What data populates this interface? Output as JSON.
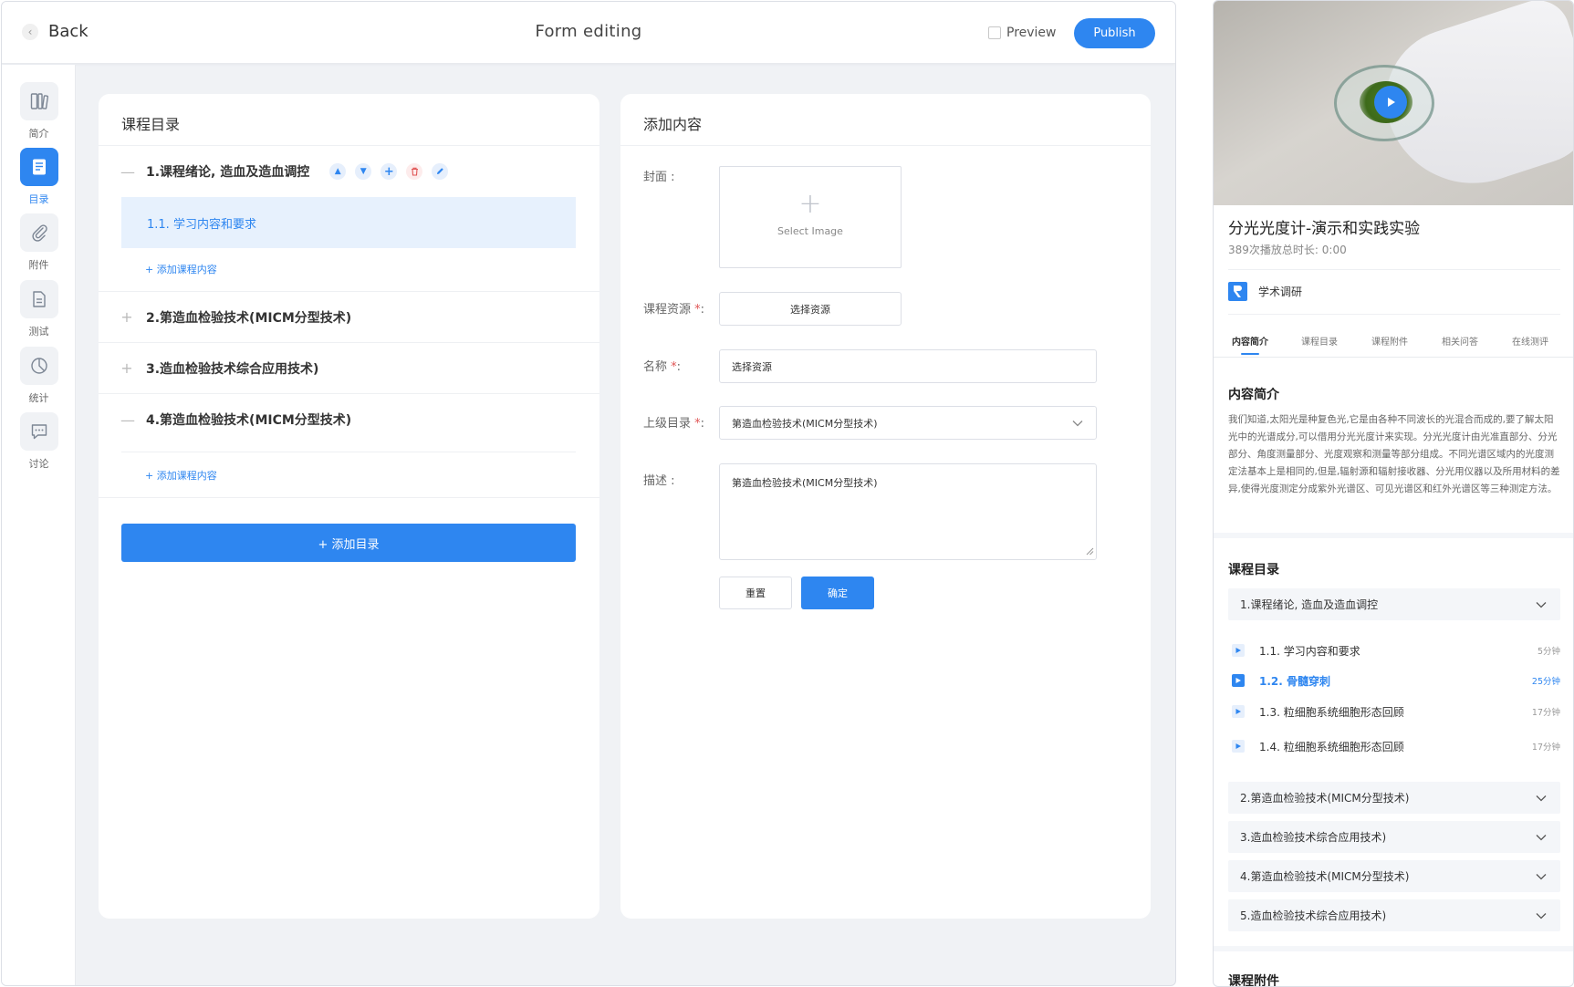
{
  "editor": {
    "topbar": {
      "back_label": "Back",
      "title": "Form editing",
      "preview_label": "Preview",
      "publish_label": "Publish"
    },
    "nav": [
      {
        "label": "简介",
        "icon": "book-icon",
        "active": false
      },
      {
        "label": "目录",
        "icon": "document-icon",
        "active": true
      },
      {
        "label": "附件",
        "icon": "paperclip-icon",
        "active": false
      },
      {
        "label": "测试",
        "icon": "test-sheet-icon",
        "active": false
      },
      {
        "label": "统计",
        "icon": "clock-chart-icon",
        "active": false
      },
      {
        "label": "讨论",
        "icon": "chat-icon",
        "active": false
      }
    ],
    "catalog": {
      "title": "课程目录",
      "chapters": [
        {
          "name": "1.课程绪论, 造血及造血调控",
          "expanded": true
        },
        {
          "name": "2.第造血检验技术(MICM分型技术)",
          "expanded": false
        },
        {
          "name": "3.造血检验技术综合应用技术)",
          "expanded": false
        },
        {
          "name": "4.第造血检验技术(MICM分型技术)",
          "expanded": true
        }
      ],
      "sub_item": "1.1. 学习内容和要求",
      "add_content": "+ 添加课程内容",
      "add_dir": "+ 添加目录"
    },
    "form": {
      "title": "添加内容",
      "cover_label": "封面 :",
      "select_image": "Select Image",
      "resource_label": "课程资源",
      "resource_button": "选择资源",
      "name_label": "名称",
      "name_value": "选择资源",
      "parent_label": "上级目录",
      "parent_value": "第造血检验技术(MICM分型技术)",
      "desc_label": "描述 :",
      "desc_value": "第造血检验技术(MICM分型技术)",
      "reset": "重置",
      "confirm": "确定",
      "required_mark": "*",
      "colon": ":"
    }
  },
  "preview": {
    "title": "分光光度计-演示和实践实验",
    "meta": "389次播放总时长: 0:00",
    "author": "学术调研",
    "tabs": [
      "内容简介",
      "课程目录",
      "课程附件",
      "相关问答",
      "在线测评"
    ],
    "active_tab": "内容简介",
    "intro_heading": "内容简介",
    "intro_text": "我们知道,太阳光是种复色光,它是由各种不同波长的光混合而成的,要了解太阳光中的光谱成分,可以借用分光光度计来实现。分光光度计由光准直部分、分光部分、角度测量部分、光度观察和测量等部分组成。不同光谱区域内的光度测定法基本上是相同的,但是,辐射源和辐射接收器、分光用仪器以及所用材料的差异,使得光度测定分成紫外光谱区、可见光谱区和红外光谱区等三种测定方法。",
    "catalog_heading": "课程目录",
    "chapter1": "1.课程绪论, 造血及造血调控",
    "lessons": [
      {
        "title": "1.1. 学习内容和要求",
        "duration": "5分钟",
        "active": false
      },
      {
        "title": "1.2. 骨髓穿刺",
        "duration": "25分钟",
        "active": true
      },
      {
        "title": "1.3. 粒细胞系统细胞形态回顾",
        "duration": "17分钟",
        "active": false
      },
      {
        "title": "1.4. 粒细胞系统细胞形态回顾",
        "duration": "17分钟",
        "active": false
      }
    ],
    "chapters": [
      "2.第造血检验技术(MICM分型技术)",
      "3.造血检验技术综合应用技术)",
      "4.第造血检验技术(MICM分型技术)",
      "5.造血检验技术综合应用技术)"
    ],
    "attachments_heading": "课程附件"
  },
  "colors": {
    "accent": "#2e86f0",
    "danger": "#e05555",
    "page_bg": "#f0f2f5",
    "highlight": "#e7f1fd"
  }
}
